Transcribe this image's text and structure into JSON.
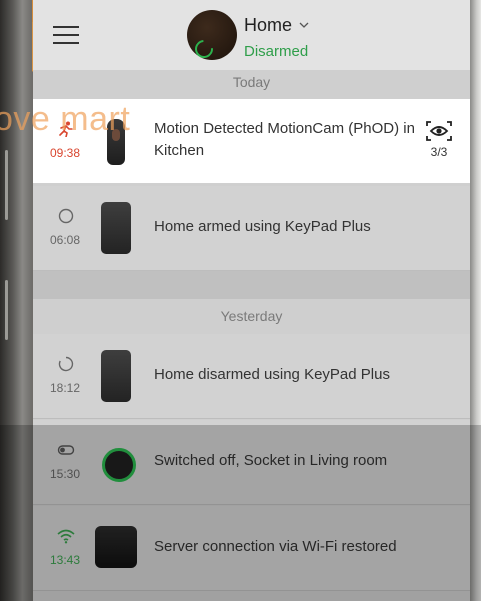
{
  "header": {
    "title": "Home",
    "status": "Disarmed"
  },
  "sections": {
    "today": "Today",
    "yesterday": "Yesterday"
  },
  "events": [
    {
      "time": "09:38",
      "text": "Motion Detected MotionCam (PhOD) in Kitchen",
      "icon": "running-man-icon",
      "photos": "3/3"
    },
    {
      "time": "06:08",
      "text": "Home armed using KeyPad Plus",
      "icon": "armed-circle-icon"
    },
    {
      "time": "18:12",
      "text": "Home disarmed using KeyPad Plus",
      "icon": "disarmed-circle-icon"
    },
    {
      "time": "15:30",
      "text": "Switched off, Socket in Living room",
      "icon": "toggle-off-icon"
    },
    {
      "time": "13:43",
      "text": "Server connection via Wi-Fi restored",
      "icon": "wifi-icon"
    }
  ],
  "watermark": "ove mart",
  "colors": {
    "accent_green": "#2f9e4a",
    "alarm_red": "#d9462f",
    "watermark_orange": "#e79a43"
  }
}
